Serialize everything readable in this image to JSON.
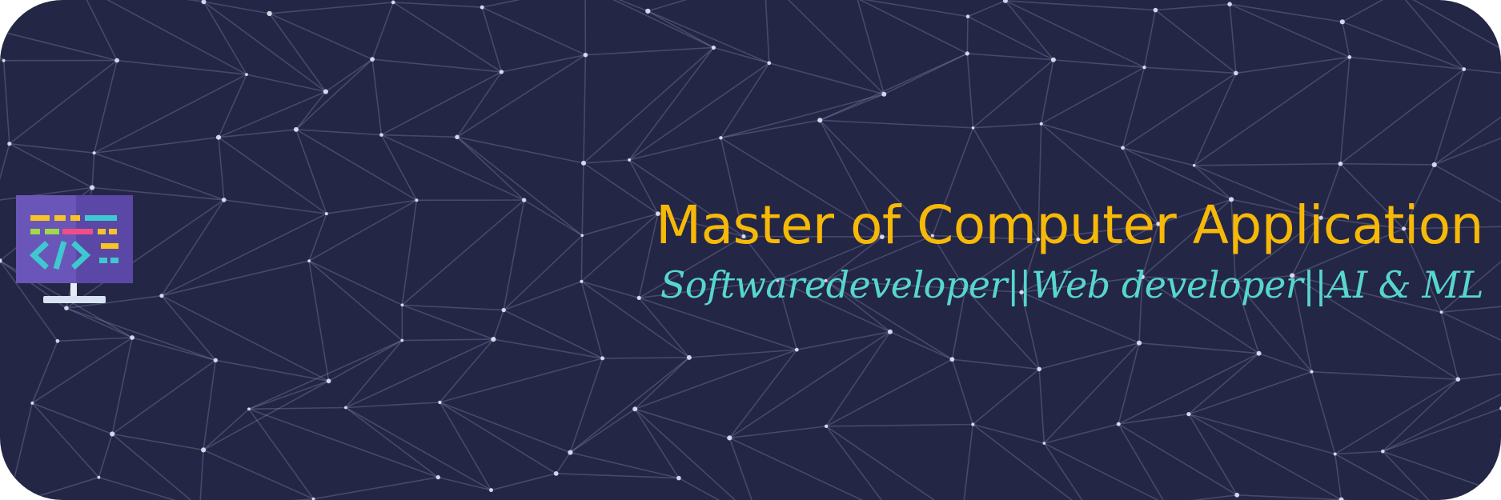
{
  "banner": {
    "title": "Master of Computer Application",
    "subtitle": "Softwaredeveloper||Web developer||AI & ML",
    "icon": "code-monitor-icon"
  },
  "colors": {
    "background": "#242645",
    "title": "#f7b908",
    "subtitle": "#56d6cf",
    "network_line": "#8a8cb3",
    "network_node": "#eef0ff"
  }
}
